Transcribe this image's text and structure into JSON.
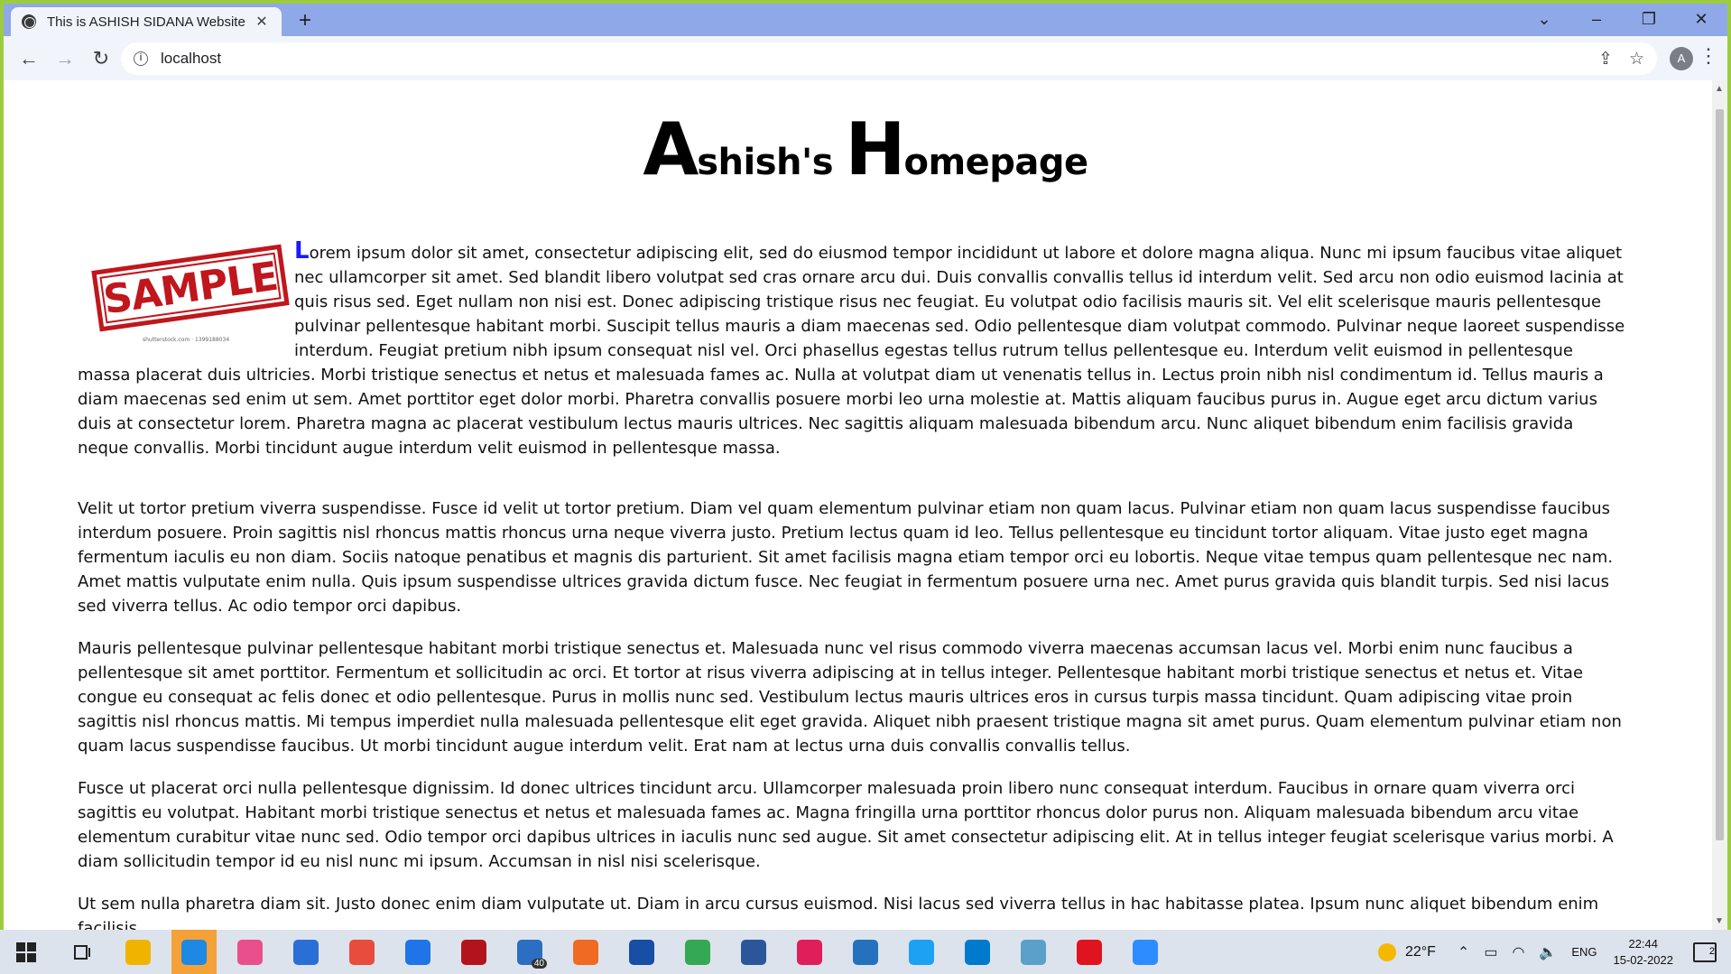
{
  "browser": {
    "tab_title": "This is ASHISH SIDANA Website",
    "url": "localhost",
    "avatar_letter": "A"
  },
  "page": {
    "title_cap1": "A",
    "title_rest1": "shish's ",
    "title_cap2": "H",
    "title_rest2": "omepage",
    "image_caption": "shutterstock.com · 1399188034",
    "stamp_text": "SAMPLE",
    "dropcap": "L",
    "paragraphs": [
      "orem ipsum dolor sit amet, consectetur adipiscing elit, sed do eiusmod tempor incididunt ut labore et dolore magna aliqua. Nunc mi ipsum faucibus vitae aliquet nec ullamcorper sit amet. Sed blandit libero volutpat sed cras ornare arcu dui. Duis convallis convallis tellus id interdum velit. Sed arcu non odio euismod lacinia at quis risus sed. Eget nullam non nisi est. Donec adipiscing tristique risus nec feugiat. Eu volutpat odio facilisis mauris sit. Vel elit scelerisque mauris pellentesque pulvinar pellentesque habitant morbi. Suscipit tellus mauris a diam maecenas sed. Odio pellentesque diam volutpat commodo. Pulvinar neque laoreet suspendisse interdum. Feugiat pretium nibh ipsum consequat nisl vel. Orci phasellus egestas tellus rutrum tellus pellentesque eu. Interdum velit euismod in pellentesque massa placerat duis ultricies. Morbi tristique senectus et netus et malesuada fames ac. Nulla at volutpat diam ut venenatis tellus in. Lectus proin nibh nisl condimentum id. Tellus mauris a diam maecenas sed enim ut sem. Amet porttitor eget dolor morbi. Pharetra convallis posuere morbi leo urna molestie at. Mattis aliquam faucibus purus in. Augue eget arcu dictum varius duis at consectetur lorem. Pharetra magna ac placerat vestibulum lectus mauris ultrices. Nec sagittis aliquam malesuada bibendum arcu. Nunc aliquet bibendum enim facilisis gravida neque convallis. Morbi tincidunt augue interdum velit euismod in pellentesque massa.",
      "Velit ut tortor pretium viverra suspendisse. Fusce id velit ut tortor pretium. Diam vel quam elementum pulvinar etiam non quam lacus. Pulvinar etiam non quam lacus suspendisse faucibus interdum posuere. Proin sagittis nisl rhoncus mattis rhoncus urna neque viverra justo. Pretium lectus quam id leo. Tellus pellentesque eu tincidunt tortor aliquam. Vitae justo eget magna fermentum iaculis eu non diam. Sociis natoque penatibus et magnis dis parturient. Sit amet facilisis magna etiam tempor orci eu lobortis. Neque vitae tempus quam pellentesque nec nam. Amet mattis vulputate enim nulla. Quis ipsum suspendisse ultrices gravida dictum fusce. Nec feugiat in fermentum posuere urna nec. Amet purus gravida quis blandit turpis. Sed nisi lacus sed viverra tellus. Ac odio tempor orci dapibus.",
      "Mauris pellentesque pulvinar pellentesque habitant morbi tristique senectus et. Malesuada nunc vel risus commodo viverra maecenas accumsan lacus vel. Morbi enim nunc faucibus a pellentesque sit amet porttitor. Fermentum et sollicitudin ac orci. Et tortor at risus viverra adipiscing at in tellus integer. Pellentesque habitant morbi tristique senectus et netus et. Vitae congue eu consequat ac felis donec et odio pellentesque. Purus in mollis nunc sed. Vestibulum lectus mauris ultrices eros in cursus turpis massa tincidunt. Quam adipiscing vitae proin sagittis nisl rhoncus mattis. Mi tempus imperdiet nulla malesuada pellentesque elit eget gravida. Aliquet nibh praesent tristique magna sit amet purus. Quam elementum pulvinar etiam non quam lacus suspendisse faucibus. Ut morbi tincidunt augue interdum velit. Erat nam at lectus urna duis convallis convallis tellus.",
      "Fusce ut placerat orci nulla pellentesque dignissim. Id donec ultrices tincidunt arcu. Ullamcorper malesuada proin libero nunc consequat interdum. Faucibus in ornare quam viverra orci sagittis eu volutpat. Habitant morbi tristique senectus et netus et malesuada fames ac. Magna fringilla urna porttitor rhoncus dolor purus non. Aliquam malesuada bibendum arcu vitae elementum curabitur vitae nunc sed. Odio tempor orci dapibus ultrices in iaculis nunc sed augue. Sit amet consectetur adipiscing elit. At in tellus integer feugiat scelerisque varius morbi. A diam sollicitudin tempor id eu nisl nunc mi ipsum. Accumsan in nisl nisi scelerisque.",
      "Ut sem nulla pharetra diam sit. Justo donec enim diam vulputate ut. Diam in arcu cursus euismod. Nisi lacus sed viverra tellus in hac habitasse platea. Ipsum nunc aliquet bibendum enim facilisis."
    ]
  },
  "taskbar": {
    "mail_badge": "40",
    "temperature": "22°F",
    "language": "ENG",
    "time": "22:44",
    "date": "15-02-2022",
    "notification_count": "2",
    "apps": [
      {
        "name": "file-explorer-icon",
        "color": "#f0b400"
      },
      {
        "name": "edge-icon",
        "color": "#1e88e5"
      },
      {
        "name": "photos-icon",
        "color": "#e94f8a"
      },
      {
        "name": "store-icon",
        "color": "#2a6fd6"
      },
      {
        "name": "chrome-icon",
        "color": "#e74c3c"
      },
      {
        "name": "dropbox-icon",
        "color": "#1f74e8"
      },
      {
        "name": "app-red-icon",
        "color": "#b3141c"
      },
      {
        "name": "mail-icon",
        "color": "#2c6ec2"
      },
      {
        "name": "brave-icon",
        "color": "#f06a22"
      },
      {
        "name": "bitwarden-icon",
        "color": "#174ea6"
      },
      {
        "name": "chrome-profile-icon",
        "color": "#34a853"
      },
      {
        "name": "word-icon",
        "color": "#2b579a"
      },
      {
        "name": "slack-icon",
        "color": "#e01e5a"
      },
      {
        "name": "powershell-icon",
        "color": "#2671be"
      },
      {
        "name": "snipaste-icon",
        "color": "#1da1f2"
      },
      {
        "name": "vscode-icon",
        "color": "#007acc"
      },
      {
        "name": "notepad-icon",
        "color": "#5aa0c8"
      },
      {
        "name": "acrobat-icon",
        "color": "#e0141e"
      },
      {
        "name": "zoom-icon",
        "color": "#2d8cff"
      }
    ]
  }
}
